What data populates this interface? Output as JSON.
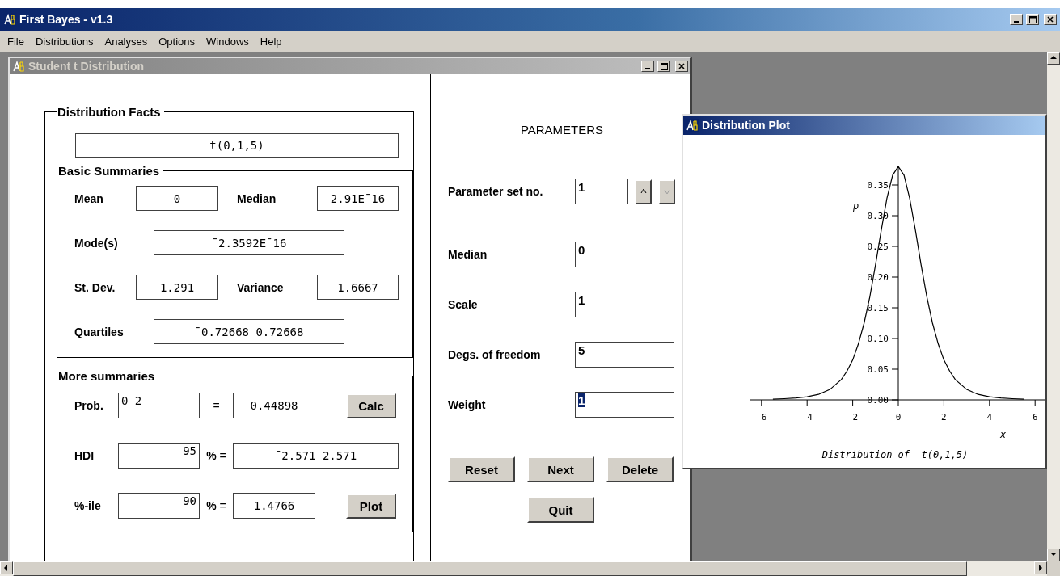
{
  "window": {
    "title": "First Bayes - v1.3"
  },
  "menu": [
    {
      "label": "File"
    },
    {
      "label": "Distributions"
    },
    {
      "label": "Analyses"
    },
    {
      "label": "Options"
    },
    {
      "label": "Windows"
    },
    {
      "label": "Help"
    }
  ],
  "student_window": {
    "title": "Student t Distribution",
    "active": false,
    "distribution_facts": {
      "title": "Distribution Facts",
      "formula": "t(0,1,5)",
      "basic_summaries": {
        "title": "Basic Summaries",
        "rows": [
          {
            "kind": "pair",
            "fields": [
              {
                "label": "Mean",
                "value": "0"
              },
              {
                "label": "Median",
                "value": "2.91E¯16"
              }
            ]
          },
          {
            "kind": "wide",
            "fields": [
              {
                "label": "Mode(s)",
                "value": "¯2.3592E¯16"
              }
            ]
          },
          {
            "kind": "pair",
            "fields": [
              {
                "label": "St. Dev.",
                "value": "1.291"
              },
              {
                "label": "Variance",
                "value": "1.6667"
              }
            ]
          },
          {
            "kind": "wide",
            "fields": [
              {
                "label": "Quartiles",
                "value": "¯0.72668 0.72668"
              }
            ]
          }
        ]
      },
      "more_summaries": {
        "title": "More summaries",
        "rows": [
          {
            "kind": "interval",
            "label": "Prob.",
            "input": "0 2",
            "equals": "=",
            "result": "0.44898",
            "button": {
              "label": "Calc"
            }
          },
          {
            "kind": "percent",
            "label": "HDI",
            "input": "95",
            "equals": "**%** =",
            "result": "¯2.571 2.571"
          },
          {
            "kind": "percent",
            "label": "%-ile",
            "input": "90",
            "equals": "**%** =",
            "result": "1.4766",
            "button": {
              "label": "Plot"
            }
          }
        ]
      }
    },
    "parameters": {
      "title": "PARAMETERS",
      "set_no": {
        "label": "Parameter set no.",
        "value": "1",
        "up_disabled": false,
        "down_disabled": true
      },
      "fields": [
        {
          "label": "Median",
          "value": "0",
          "selected": false
        },
        {
          "label": "Scale",
          "value": "1",
          "selected": false
        },
        {
          "label": "Degs. of freedom",
          "value": "5",
          "selected": false
        },
        {
          "label": "Weight",
          "value": "1",
          "selected": true
        }
      ],
      "buttons": [
        {
          "label": "Reset"
        },
        {
          "label": "Next"
        },
        {
          "label": "Delete"
        }
      ],
      "quit": {
        "label": "Quit"
      }
    }
  },
  "plot_window": {
    "title": "Distribution Plot",
    "active": true,
    "chart_data": {
      "type": "line",
      "title": "Distribution of  t(0,1,5)",
      "xlabel": "x",
      "ylabel": "p",
      "x": [
        -5.5,
        -5,
        -4.5,
        -4,
        -3.5,
        -3,
        -2.5,
        -2.25,
        -2,
        -1.75,
        -1.5,
        -1.25,
        -1,
        -0.75,
        -0.5,
        -0.25,
        0,
        0.25,
        0.5,
        0.75,
        1,
        1.25,
        1.5,
        1.75,
        2,
        2.25,
        2.5,
        3,
        3.5,
        4,
        4.5,
        5,
        5.5
      ],
      "series": [
        {
          "color": "#000000",
          "values": [
            0.001,
            0.002,
            0.003,
            0.005,
            0.009,
            0.017,
            0.033,
            0.047,
            0.065,
            0.091,
            0.125,
            0.168,
            0.22,
            0.276,
            0.328,
            0.366,
            0.38,
            0.366,
            0.328,
            0.276,
            0.22,
            0.168,
            0.125,
            0.091,
            0.065,
            0.047,
            0.033,
            0.017,
            0.009,
            0.005,
            0.003,
            0.002,
            0.001
          ]
        }
      ],
      "xlim": [
        -6.5,
        6.5
      ],
      "ylim": [
        0,
        0.38
      ],
      "xticks": [
        {
          "value": -6,
          "label": "¯6"
        },
        {
          "value": -4,
          "label": "¯4"
        },
        {
          "value": -2,
          "label": "¯2"
        },
        {
          "value": 0,
          "label": "0"
        },
        {
          "value": 2,
          "label": "2"
        },
        {
          "value": 4,
          "label": "4"
        },
        {
          "value": 6,
          "label": "6"
        }
      ],
      "yticks": [
        {
          "value": 0,
          "label": "0.00"
        },
        {
          "value": 0.05,
          "label": "0.05"
        },
        {
          "value": 0.1,
          "label": "0.10"
        },
        {
          "value": 0.15,
          "label": "0.15"
        },
        {
          "value": 0.2,
          "label": "0.20"
        },
        {
          "value": 0.25,
          "label": "0.25"
        },
        {
          "value": 0.3,
          "label": "0.30"
        },
        {
          "value": 0.35,
          "label": "0.35"
        }
      ]
    }
  }
}
